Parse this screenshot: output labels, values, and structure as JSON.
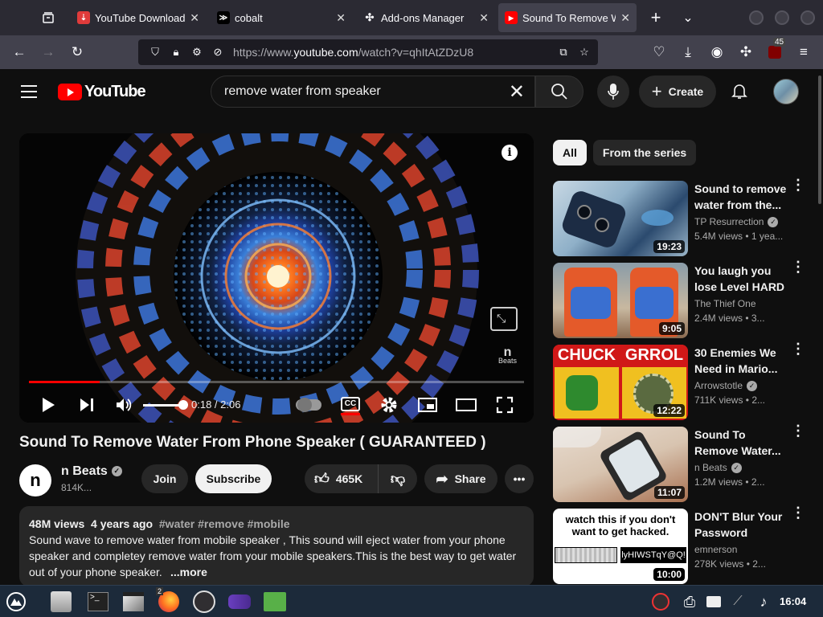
{
  "browser": {
    "tabs": [
      {
        "label": "YouTube Downloader",
        "icon": "downloader-favicon-icon",
        "color": "#e03b3b",
        "active": false
      },
      {
        "label": "cobalt",
        "icon": "cobalt-favicon-icon",
        "color": "#000000",
        "active": false
      },
      {
        "label": "Add-ons Manager",
        "icon": "puzzle-icon",
        "color": "#2b2a33",
        "active": false
      },
      {
        "label": "Sound To Remove Wa",
        "icon": "youtube-favicon-icon",
        "color": "#ff0000",
        "active": true
      }
    ],
    "url_prefix": "https://www.",
    "url_domain": "youtube.com",
    "url_path": "/watch?v=qhItAtZDzU8",
    "extension_badge": "45"
  },
  "youtube": {
    "logo_text": "YouTube",
    "search_query": "remove water from speaker",
    "create_label": "Create"
  },
  "video": {
    "title": "Sound To Remove Water From Phone Speaker ( GUARANTEED )",
    "time": "0:18 / 2:06",
    "progress_fraction": 0.143,
    "volume_fraction": 1.0,
    "watermark": "Beats",
    "cc_label": "CC",
    "channel": {
      "name": "n Beats",
      "avatar_letter": "n",
      "subscribers": "814K..."
    },
    "join_label": "Join",
    "subscribe_label": "Subscribe",
    "likes": "465K",
    "share_label": "Share",
    "description": {
      "views": "48M views",
      "age": "4 years ago",
      "tags": "#water #remove #mobile",
      "text": "Sound wave to remove water from mobile speaker , This sound will eject water from your phone speaker and completey remove water from your mobile speakers.This is the best way to get water out of your phone speaker.",
      "more_label": "...more"
    }
  },
  "sidebar": {
    "chips": [
      "All",
      "From the series"
    ],
    "recommendations": [
      {
        "title": "Sound to remove water from the...",
        "channel": "TP Resurrection",
        "verified": true,
        "meta": "5.4M views • 1 yea...",
        "duration": "19:23"
      },
      {
        "title": "You laugh you lose Level HARD",
        "channel": "The Thief One",
        "verified": false,
        "meta": "2.4M views • 3...",
        "duration": "9:05"
      },
      {
        "title": "30 Enemies We Need in Mario...",
        "channel": "Arrowstotle",
        "verified": true,
        "meta": "711K views • 2...",
        "duration": "12:22",
        "thumb_text_left": "CHUCK",
        "thumb_text_right": "GRROL"
      },
      {
        "title": "Sound To Remove Water...",
        "channel": "n Beats",
        "verified": true,
        "meta": "1.2M views • 2...",
        "duration": "11:07"
      },
      {
        "title": "DON'T Blur Your Password",
        "channel": "emnerson",
        "verified": false,
        "meta": "278K views • 2...",
        "duration": "10:00",
        "thumb_text": "watch this if you don't want to get hacked.",
        "thumb_pw": "lyHIWSTqY@Q!"
      }
    ]
  },
  "taskbar": {
    "clock": "16:04",
    "firefox_badge": "2"
  }
}
